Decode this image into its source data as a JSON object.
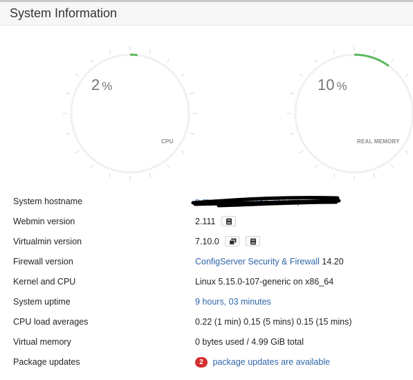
{
  "panel": {
    "title": "System Information"
  },
  "gauges": [
    {
      "label": "CPU",
      "value": "2",
      "unit": "%",
      "fraction": 0.02,
      "color": "#5cb85c"
    },
    {
      "label": "REAL MEMORY",
      "value": "10",
      "unit": "%",
      "fraction": 0.1,
      "color": "#5cb85c"
    }
  ],
  "info": {
    "hostname": {
      "label": "System hostname",
      "value": "p.myserver.info (84.247.1x)"
    },
    "webmin": {
      "label": "Webmin version",
      "value": "2.111",
      "button_icon": "book-icon"
    },
    "virtualmin": {
      "label": "Virtualmin version",
      "value": "7.10.0",
      "button_icons": [
        "copy-icon",
        "book-icon"
      ]
    },
    "firewall": {
      "label": "Firewall version",
      "link": "ConfigServer Security & Firewall",
      "version": "14.20"
    },
    "kernel": {
      "label": "Kernel and CPU",
      "value": "Linux 5.15.0-107-generic on x86_64"
    },
    "uptime": {
      "label": "System uptime",
      "value": "9 hours, 03 minutes"
    },
    "load": {
      "label": "CPU load averages",
      "value": "0.22 (1 min) 0.15 (5 mins) 0.15 (15 mins)"
    },
    "vmem": {
      "label": "Virtual memory",
      "value": "0 bytes used / 4.99 GiB total"
    },
    "packages": {
      "label": "Package updates",
      "count": "2",
      "link": "package updates are available",
      "badge_color": "#d32f2f"
    }
  }
}
